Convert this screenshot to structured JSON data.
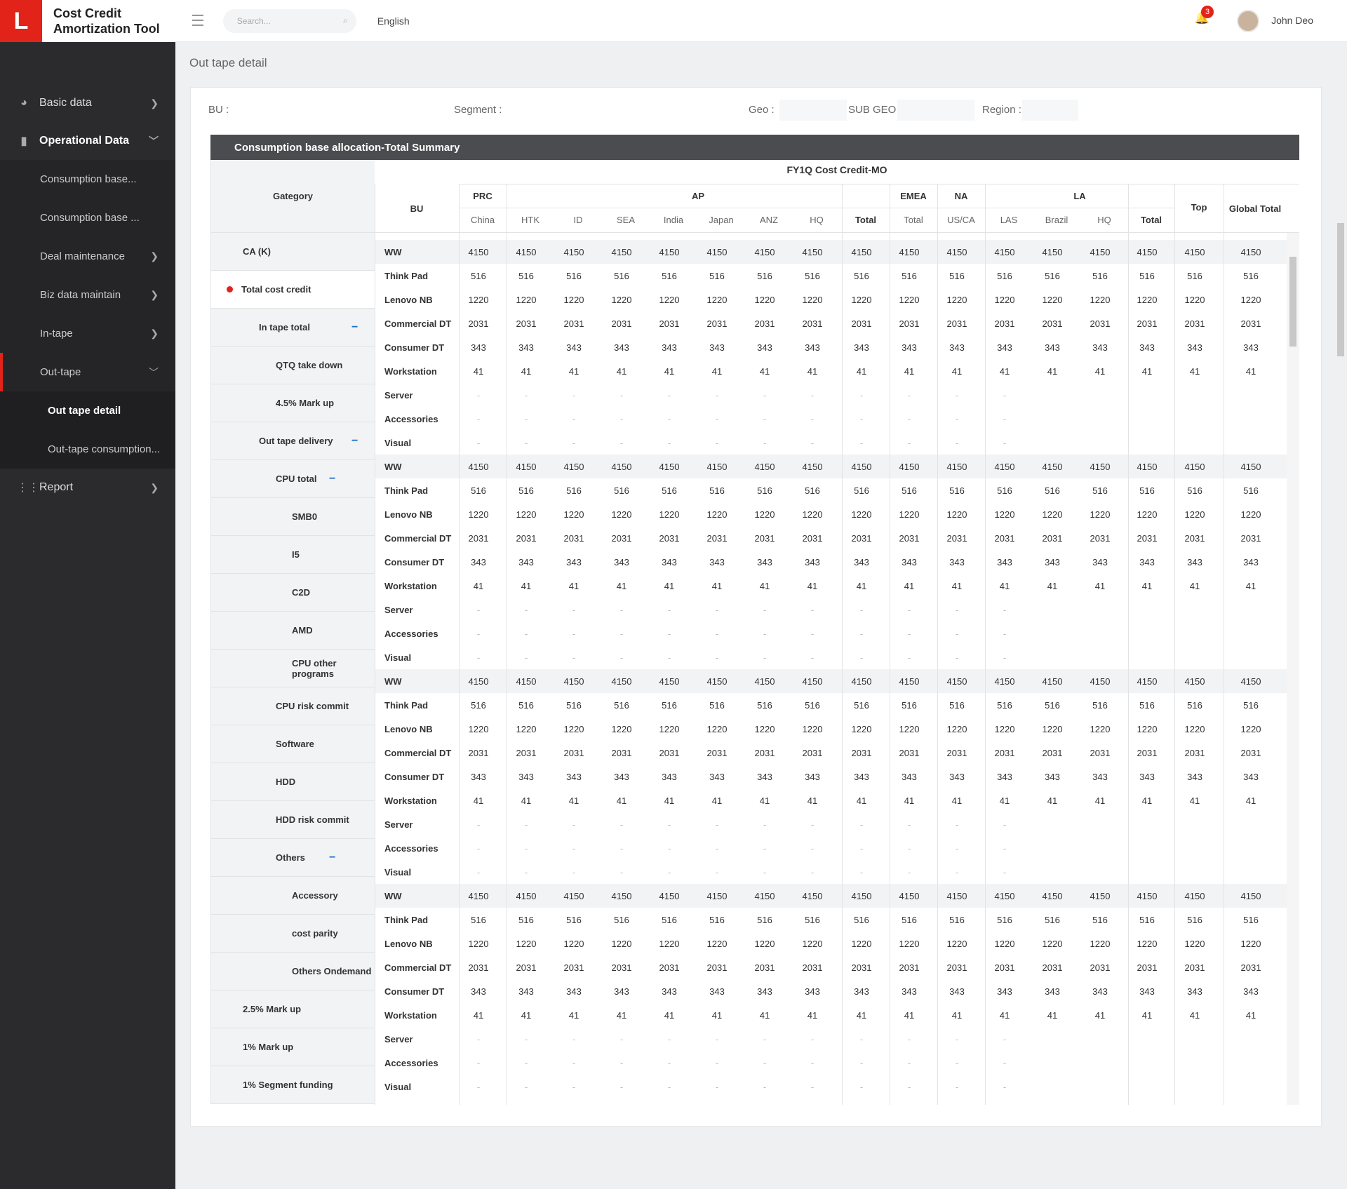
{
  "app": {
    "logo": "L",
    "title_line1": "Cost Credit",
    "title_line2": "Amortization Tool"
  },
  "topbar": {
    "search_placeholder": "Search...",
    "language": "English",
    "notifications": "3",
    "user": "John Deo"
  },
  "sidebar": {
    "basic": "Basic data",
    "operational": "Operational Data",
    "sub1": "Consumption base...",
    "sub2": "Consumption base ...",
    "sub3": "Deal maintenance",
    "sub4": "Biz data maintain",
    "sub5": "In-tape",
    "sub6": "Out-tape",
    "outtape_detail": "Out tape detail",
    "outtape_cons": "Out-tape consumption...",
    "report": "Report"
  },
  "page": {
    "title": "Out tape detail"
  },
  "filters": {
    "bu": "BU :",
    "segment": "Segment :",
    "geo": "Geo :",
    "subgeo": "SUB GEO :",
    "region": "Region :"
  },
  "table": {
    "title": "Consumption base allocation-Total Summary",
    "category_header": "Gategory",
    "main_header": "FY1Q Cost Credit-MO",
    "bu_header": "BU",
    "groups": {
      "prc": "PRC",
      "ap": "AP",
      "emea": "EMEA",
      "na": "NA",
      "la": "LA",
      "top": "Top",
      "global": "Global Total"
    },
    "cols": [
      "China",
      "HTK",
      "ID",
      "SEA",
      "India",
      "Japan",
      "ANZ",
      "HQ",
      "Total",
      "Total",
      "US/CA",
      "LAS",
      "Brazil",
      "HQ",
      "Total"
    ],
    "categories": [
      "CA (K)",
      "Total cost credit",
      "In tape total",
      "QTQ take down",
      "4.5% Mark up",
      "Out tape delivery",
      "CPU total",
      "SMB0",
      "I5",
      "C2D",
      "AMD",
      "CPU other programs",
      "CPU risk commit",
      "Software",
      "HDD",
      "HDD risk commit",
      "Others",
      "Accessory",
      "cost parity",
      "Others Ondemand",
      "2.5% Mark up",
      "1% Mark up",
      "1% Segment funding"
    ],
    "partial_label": "Visual",
    "bus": [
      "WW",
      "Think Pad",
      "Lenovo NB",
      "Commercial DT",
      "Consumer DT",
      "Workstation",
      "Server",
      "Accessories",
      "Visual"
    ],
    "values": {
      "WW": "4150",
      "Think Pad": "516",
      "Lenovo NB": "1220",
      "Commercial DT": "2031",
      "Consumer DT": "343",
      "Workstation": "41",
      "Server": "-",
      "Accessories": "-",
      "Visual": "-"
    }
  }
}
